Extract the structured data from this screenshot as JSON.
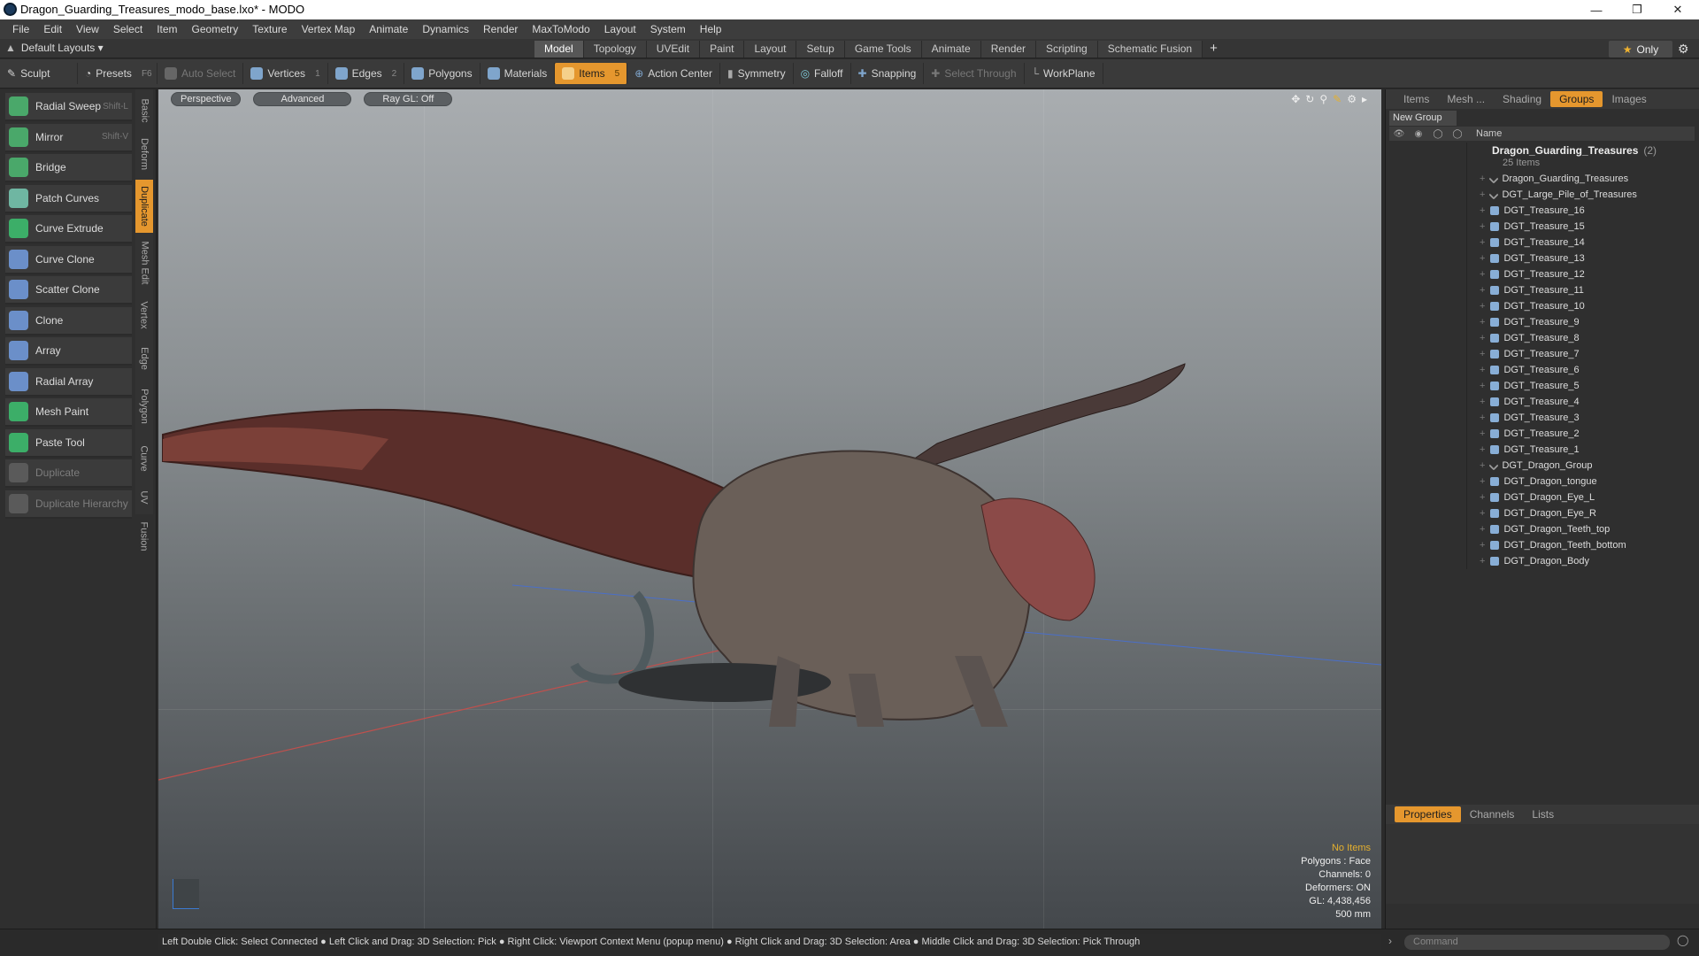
{
  "window": {
    "title": "Dragon_Guarding_Treasures_modo_base.lxo* - MODO",
    "controls": [
      "minimize",
      "maximize",
      "close"
    ]
  },
  "menu": [
    "File",
    "Edit",
    "View",
    "Select",
    "Item",
    "Geometry",
    "Texture",
    "Vertex Map",
    "Animate",
    "Dynamics",
    "Render",
    "MaxToModo",
    "Layout",
    "System",
    "Help"
  ],
  "modebar": {
    "layouts_label": "Default Layouts ▾",
    "tabs": [
      "Model",
      "Topology",
      "UVEdit",
      "Paint",
      "Layout",
      "Setup",
      "Game Tools",
      "Animate",
      "Render",
      "Scripting",
      "Schematic Fusion"
    ],
    "active_tab": "Model",
    "plus": "+",
    "only_label": "Only"
  },
  "toolbar": {
    "sculpt": "Sculpt",
    "presets": "Presets",
    "presets_key": "F6",
    "auto_select": "Auto Select",
    "vertices": "Vertices",
    "vertices_num": "1",
    "edges": "Edges",
    "edges_num": "2",
    "polygons": "Polygons",
    "materials": "Materials",
    "items": "Items",
    "items_num": "5",
    "action_center": "Action Center",
    "symmetry": "Symmetry",
    "falloff": "Falloff",
    "snapping": "Snapping",
    "select_through": "Select Through",
    "workplane": "WorkPlane"
  },
  "tools": [
    {
      "label": "Radial Sweep",
      "shortcut": "Shift-L",
      "color": "#4aa86a"
    },
    {
      "label": "Mirror",
      "shortcut": "Shift-V",
      "color": "#4aa86a"
    },
    {
      "label": "Bridge",
      "shortcut": "",
      "color": "#4aa86a"
    },
    {
      "label": "Patch Curves",
      "shortcut": "",
      "color": "#6fb6a2"
    },
    {
      "label": "Curve Extrude",
      "shortcut": "",
      "color": "#3cae68"
    },
    {
      "label": "Curve Clone",
      "shortcut": "",
      "color": "#6b8fc9"
    },
    {
      "label": "Scatter Clone",
      "shortcut": "",
      "color": "#6b8fc9"
    },
    {
      "label": "Clone",
      "shortcut": "",
      "color": "#6b8fc9"
    },
    {
      "label": "Array",
      "shortcut": "",
      "color": "#6b8fc9"
    },
    {
      "label": "Radial Array",
      "shortcut": "",
      "color": "#6b8fc9"
    },
    {
      "label": "Mesh Paint",
      "shortcut": "",
      "color": "#3cae68"
    },
    {
      "label": "Paste Tool",
      "shortcut": "",
      "color": "#3cae68"
    },
    {
      "label": "Duplicate",
      "shortcut": "",
      "color": "#5a5a5a",
      "disabled": true
    },
    {
      "label": "Duplicate Hierarchy",
      "shortcut": "",
      "color": "#5a5a5a",
      "disabled": true
    }
  ],
  "vertical_tabs": [
    "Basic",
    "Deform",
    "Duplicate",
    "Mesh Edit",
    "Vertex",
    "Edge",
    "Polygon",
    "Curve",
    "UV",
    "Fusion"
  ],
  "viewport": {
    "perspective": "Perspective",
    "advanced": "Advanced",
    "raygl": "Ray GL: Off",
    "info": [
      "No Items",
      "Polygons : Face",
      "Channels: 0",
      "Deformers: ON",
      "GL: 4,438,456",
      "500 mm"
    ]
  },
  "right_panel": {
    "tabs": [
      "Items",
      "Mesh ...",
      "Shading",
      "Groups",
      "Images"
    ],
    "active_tab": "Groups",
    "new_group": "New Group",
    "name_header": "Name",
    "root": {
      "label": "Dragon_Guarding_Treasures",
      "count": "(2)",
      "items": "25 Items"
    },
    "items": [
      {
        "label": "Dragon_Guarding_Treasures",
        "type": "locator"
      },
      {
        "label": "DGT_Large_Pile_of_Treasures",
        "type": "locator"
      },
      {
        "label": "DGT_Treasure_16",
        "type": "mesh"
      },
      {
        "label": "DGT_Treasure_15",
        "type": "mesh"
      },
      {
        "label": "DGT_Treasure_14",
        "type": "mesh"
      },
      {
        "label": "DGT_Treasure_13",
        "type": "mesh"
      },
      {
        "label": "DGT_Treasure_12",
        "type": "mesh"
      },
      {
        "label": "DGT_Treasure_11",
        "type": "mesh"
      },
      {
        "label": "DGT_Treasure_10",
        "type": "mesh"
      },
      {
        "label": "DGT_Treasure_9",
        "type": "mesh"
      },
      {
        "label": "DGT_Treasure_8",
        "type": "mesh"
      },
      {
        "label": "DGT_Treasure_7",
        "type": "mesh"
      },
      {
        "label": "DGT_Treasure_6",
        "type": "mesh"
      },
      {
        "label": "DGT_Treasure_5",
        "type": "mesh"
      },
      {
        "label": "DGT_Treasure_4",
        "type": "mesh"
      },
      {
        "label": "DGT_Treasure_3",
        "type": "mesh"
      },
      {
        "label": "DGT_Treasure_2",
        "type": "mesh"
      },
      {
        "label": "DGT_Treasure_1",
        "type": "mesh"
      },
      {
        "label": "DGT_Dragon_Group",
        "type": "locator"
      },
      {
        "label": "DGT_Dragon_tongue",
        "type": "mesh"
      },
      {
        "label": "DGT_Dragon_Eye_L",
        "type": "mesh"
      },
      {
        "label": "DGT_Dragon_Eye_R",
        "type": "mesh"
      },
      {
        "label": "DGT_Dragon_Teeth_top",
        "type": "mesh"
      },
      {
        "label": "DGT_Dragon_Teeth_bottom",
        "type": "mesh"
      },
      {
        "label": "DGT_Dragon_Body",
        "type": "mesh"
      }
    ],
    "props_tabs": [
      "Properties",
      "Channels",
      "Lists"
    ],
    "active_props_tab": "Properties",
    "command_placeholder": "Command"
  },
  "status": "Left Double Click: Select Connected ● Left Click and Drag: 3D Selection: Pick ● Right Click: Viewport Context Menu (popup menu) ● Right Click and Drag: 3D Selection: Area ● Middle Click and Drag: 3D Selection: Pick Through",
  "colors": {
    "accent": "#e5972e",
    "selected_tab": "#575757"
  }
}
